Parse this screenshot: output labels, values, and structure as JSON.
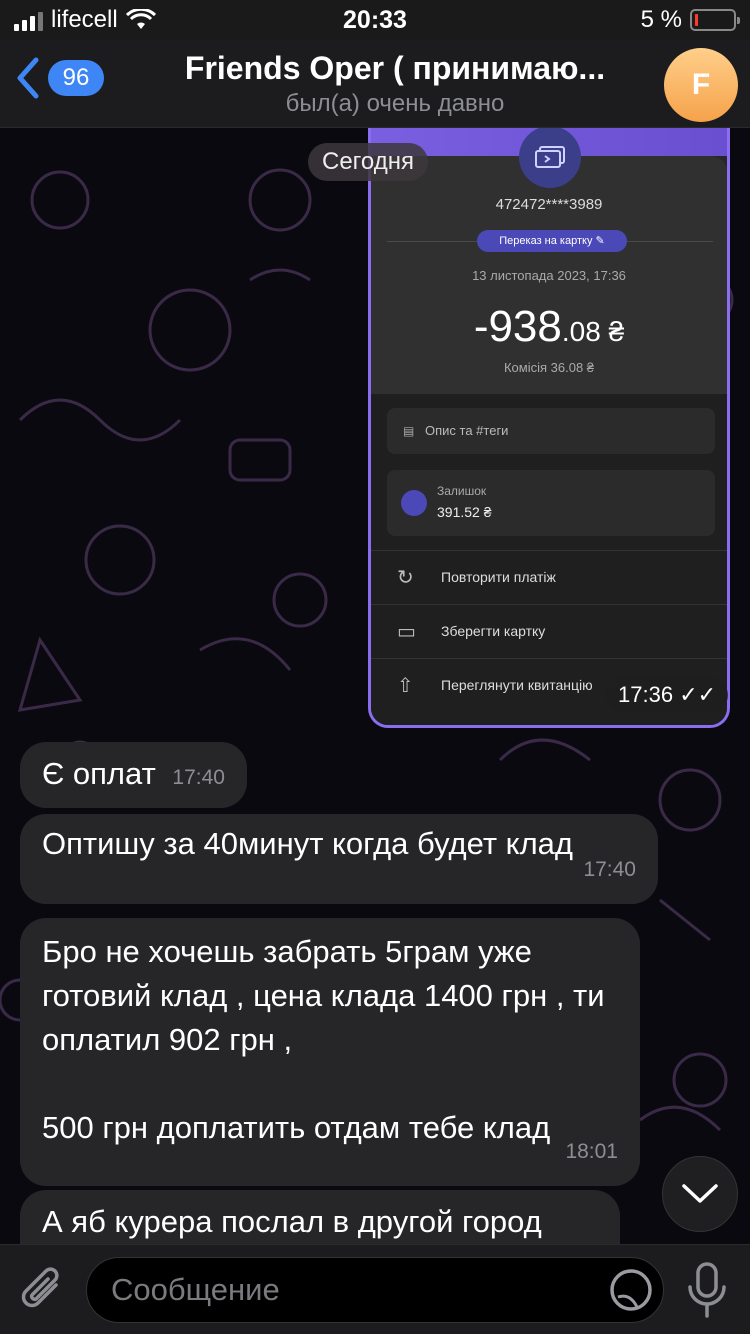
{
  "status_bar": {
    "carrier": "lifecell",
    "time": "20:33",
    "battery_percent": "5 %",
    "battery_level": 0.05
  },
  "header": {
    "back_count": "96",
    "title": "Friends Oper ( принимаю...",
    "status": "был(а) очень давно",
    "avatar_letter": "F"
  },
  "date_separator": "Сегодня",
  "receipt": {
    "card_number": "472472****3989",
    "tag": "Переказ на картку ✎",
    "datetime": "13 листопада 2023, 17:36",
    "amount_main": "-938",
    "amount_frac": ".08 ₴",
    "fee": "Комісія 36.08 ₴",
    "description_placeholder": "Опис та #теги",
    "balance_label": "Залишок",
    "balance_value": "391.52 ₴",
    "actions": [
      "Повторити платіж",
      "Зберегти картку",
      "Переглянути квитанцію"
    ],
    "time": "17:36"
  },
  "messages": [
    {
      "text": "Є оплат",
      "time": "17:40"
    },
    {
      "text": "Оптишу за 40минут когда будет клад",
      "time": "17:40"
    },
    {
      "text": "Бро не хочешь забрать 5грам уже готовий клад , цена клада 1400 грн , ти оплатил 902 грн ,",
      "text2": "500 грн доплатить отдам тебе клад",
      "time": "18:01"
    },
    {
      "text": "А яб курера послал в другой город",
      "time": ""
    }
  ],
  "input": {
    "placeholder": "Сообщение"
  },
  "colors": {
    "accent": "#3e86f5",
    "bubble": "#262628",
    "receipt_border": "#8b6df0",
    "avatar": "#f5a24a"
  }
}
